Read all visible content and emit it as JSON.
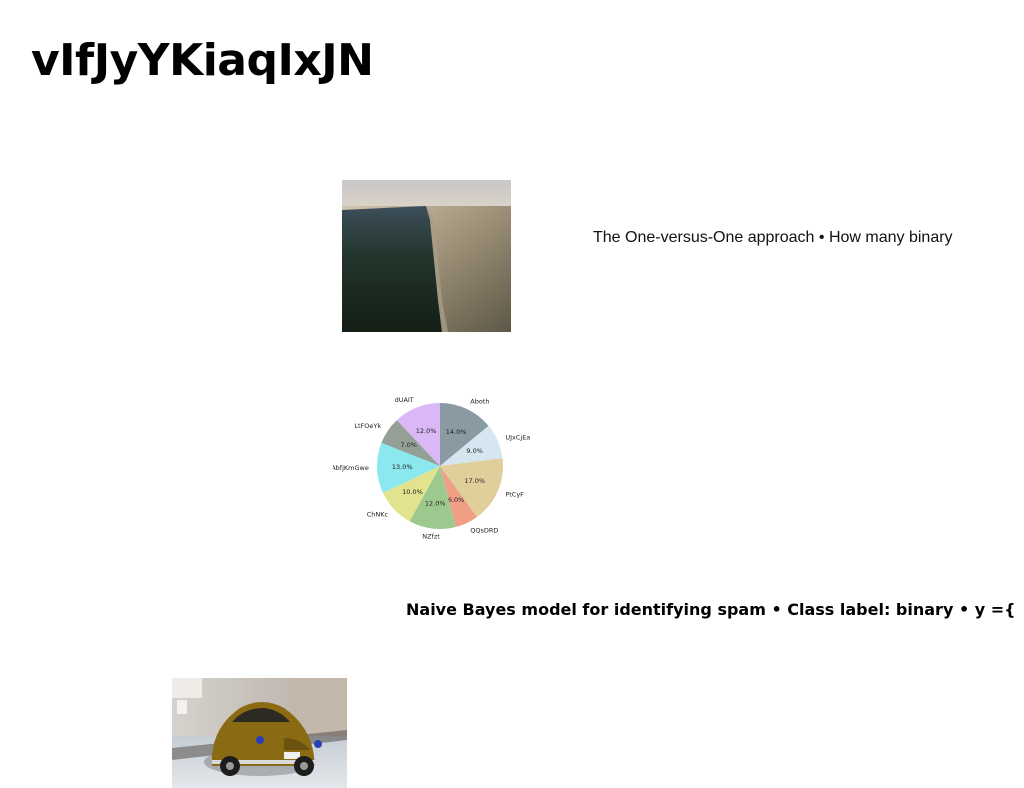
{
  "page": {
    "title": "vIfJyYKiaqIxJN"
  },
  "captions": {
    "first": "The One-versus-One approach • How many binary",
    "second": "Naive Bayes model for identifying spam • Class label: binary • y ={"
  },
  "images": {
    "coast": "aerial-coastline-photo",
    "car": "vintage-beetle-car-photo"
  },
  "chart_data": {
    "type": "pie",
    "title": "",
    "categories": [
      "Aboth",
      "UJxCjEa",
      "PtCyF",
      "QQsDRD",
      "NZfzt",
      "ChNKc",
      "AbfjKmGwe",
      "LtFOeYk",
      "dUAIT"
    ],
    "values": [
      14.0,
      9.0,
      17.0,
      6.0,
      12.0,
      10.0,
      13.0,
      7.0,
      12.0
    ],
    "value_labels": [
      "14.0%",
      "9.0%",
      "17.0%",
      "6.0%",
      "12.0%",
      "10.0%",
      "13.0%",
      "7.0%",
      "12.0%"
    ],
    "colors": [
      "#8a9aa3",
      "#d5e6f0",
      "#e0cf9a",
      "#ef9f86",
      "#9ec98e",
      "#e2e38e",
      "#8ae8ee",
      "#949f98",
      "#d9b8f5"
    ],
    "start": "top",
    "direction": "clockwise"
  }
}
